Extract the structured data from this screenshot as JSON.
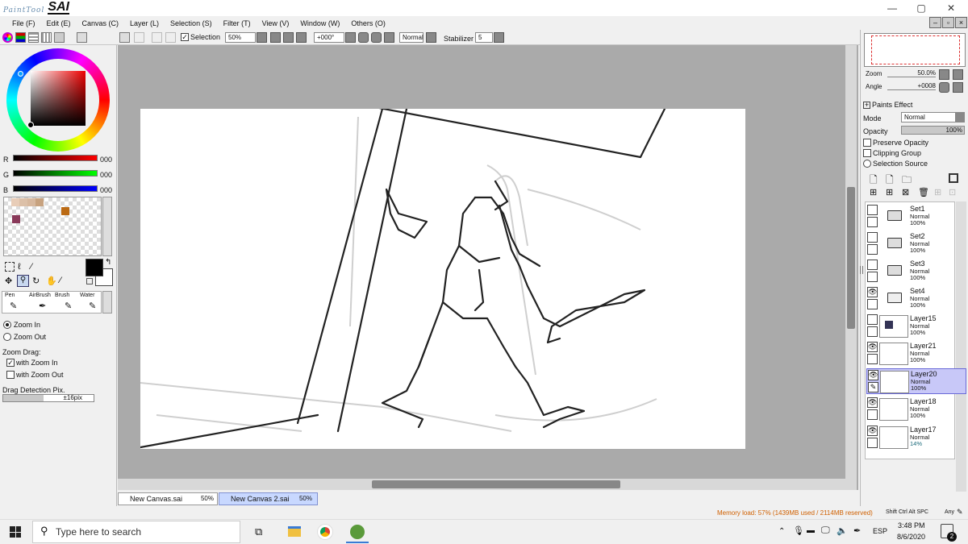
{
  "app": {
    "logo_small": "PaintTool",
    "logo_big": "SAI"
  },
  "window": {
    "minimize": "—",
    "maximize": "▢",
    "close": "✕"
  },
  "menu": [
    "File (F)",
    "Edit (E)",
    "Canvas (C)",
    "Layer (L)",
    "Selection (S)",
    "Filter (T)",
    "View (V)",
    "Window (W)",
    "Others (O)"
  ],
  "toolbar": {
    "selection_label": "Selection",
    "zoom_value": "50%",
    "angle_value": "+000°",
    "blend_mode": "Normal",
    "stabilizer_label": "Stabilizer",
    "stabilizer_value": "5"
  },
  "colors": {
    "r_label": "R",
    "r_value": "000",
    "g_label": "G",
    "g_value": "000",
    "b_label": "B",
    "b_value": "000",
    "foreground": "#000000",
    "background": "#ffffff"
  },
  "tools": {
    "pen": "Pen",
    "airbrush": "AirBrush",
    "brush": "Brush",
    "water": "Water",
    "zoom_in": "Zoom In",
    "zoom_out": "Zoom Out",
    "zoom_drag": "Zoom Drag:",
    "with_zoom_in": "with Zoom In",
    "with_zoom_out": "with Zoom Out",
    "drag_detection": "Drag Detection Pix.",
    "drag_value": "±16pix"
  },
  "navigator": {
    "zoom_label": "Zoom",
    "zoom_value": "50.0%",
    "angle_label": "Angle",
    "angle_value": "+0008"
  },
  "paints_effect": {
    "title": "Paints Effect",
    "mode_label": "Mode",
    "mode_value": "Normal",
    "opacity_label": "Opacity",
    "opacity_value": "100%",
    "preserve_opacity": "Preserve Opacity",
    "clipping_group": "Clipping Group",
    "selection_source": "Selection Source"
  },
  "layers": [
    {
      "name": "Set1",
      "mode": "Normal",
      "opacity": "100%",
      "type": "set",
      "visible": false
    },
    {
      "name": "Set2",
      "mode": "Normal",
      "opacity": "100%",
      "type": "set",
      "visible": false
    },
    {
      "name": "Set3",
      "mode": "Normal",
      "opacity": "100%",
      "type": "set",
      "visible": false
    },
    {
      "name": "Set4",
      "mode": "Normal",
      "opacity": "100%",
      "type": "set",
      "visible": true
    },
    {
      "name": "Layer15",
      "mode": "Normal",
      "opacity": "100%",
      "type": "layer",
      "visible": false
    },
    {
      "name": "Layer21",
      "mode": "Normal",
      "opacity": "100%",
      "type": "layer",
      "visible": true
    },
    {
      "name": "Layer20",
      "mode": "Normal",
      "opacity": "100%",
      "type": "layer",
      "visible": true,
      "selected": true
    },
    {
      "name": "Layer18",
      "mode": "Normal",
      "opacity": "100%",
      "type": "layer",
      "visible": true
    },
    {
      "name": "Layer17",
      "mode": "Normal",
      "opacity": "14%",
      "type": "layer",
      "visible": true
    }
  ],
  "file_tabs": [
    {
      "name": "New Canvas.sai",
      "zoom": "50%",
      "active": false
    },
    {
      "name": "New Canvas 2.sai",
      "zoom": "50%",
      "active": true
    }
  ],
  "status": {
    "memory": "Memory load: 57% (1439MB used / 2114MB reserved)",
    "keys": "Shift Ctrl Alt SPC",
    "any": "Any"
  },
  "taskbar": {
    "search_placeholder": "Type here to search",
    "lang": "ESP",
    "time": "3:48 PM",
    "date": "8/6/2020",
    "notifications": "2"
  },
  "swatches": [
    "#e8cdb8",
    "#dcc0a8",
    "#d7b89e",
    "#c7a27f",
    "#bb6a14",
    "#8a3a5a"
  ]
}
